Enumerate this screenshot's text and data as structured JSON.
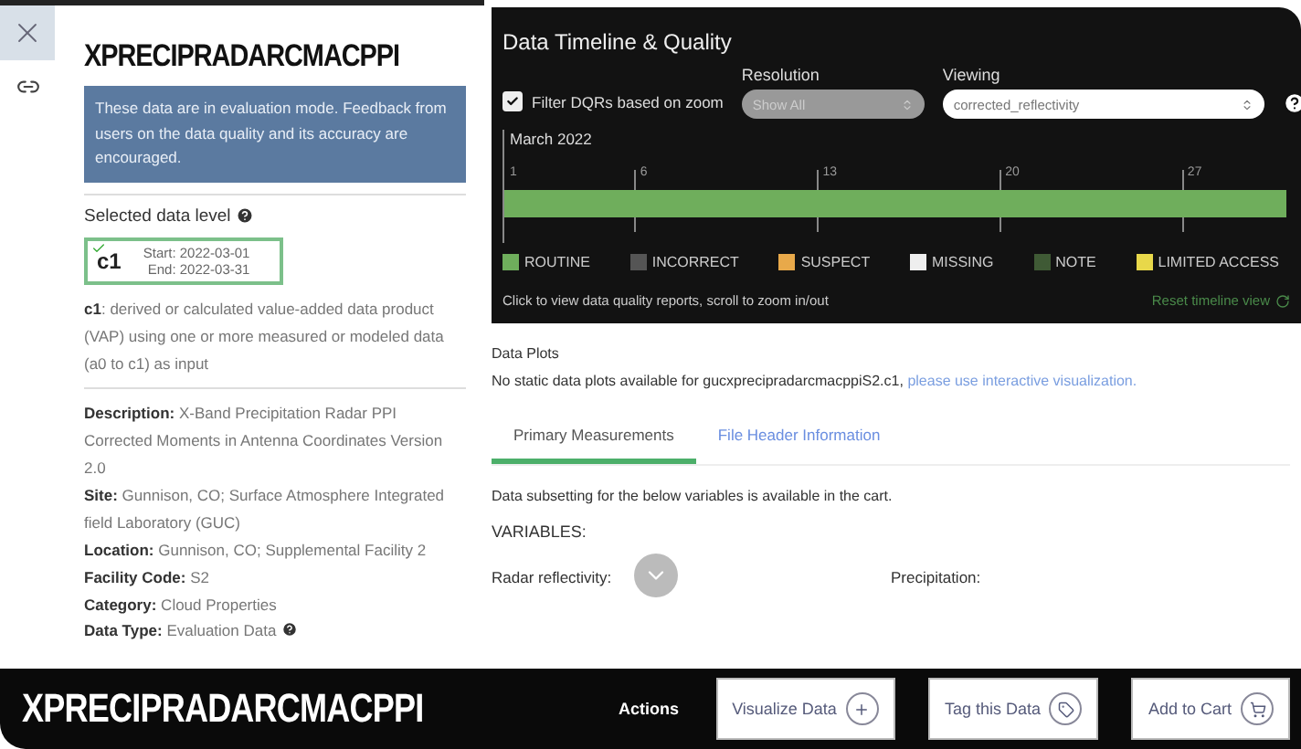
{
  "title": "XPRECIPRADARCMACPPI",
  "notice": "These data are in evaluation mode. Feedback from users on the data quality and its accuracy are encouraged.",
  "data_level": {
    "heading": "Selected data level",
    "code": "c1",
    "start": "Start: 2022-03-01",
    "end": "End: 2022-03-31",
    "selected": true
  },
  "level_description": "**c1**: derived or calculated value-added data product (VAP) using one or more measured or modeled data (a0 to c1) as input",
  "details": [
    {
      "text": "**Description:** X-Band Precipitation Radar PPI Corrected Moments in Antenna Coordinates Version 2.0",
      "help": false
    },
    {
      "text": "**Site:** Gunnison, CO; Surface Atmosphere Integrated field Laboratory (GUC)",
      "help": false
    },
    {
      "text": "**Location:** Gunnison, CO; Supplemental Facility 2",
      "help": false
    },
    {
      "text": "**Facility Code:** S2",
      "help": false
    },
    {
      "text": "**Category:** Cloud Properties",
      "help": false
    },
    {
      "text": "**Data Type:** Evaluation Data",
      "help": true
    }
  ],
  "timeline": {
    "title": "Data Timeline & Quality",
    "filter": {
      "label": "Filter DQRs based on zoom",
      "checked": true
    },
    "resolution": {
      "label": "Resolution",
      "value": "Show All",
      "disabled": true
    },
    "viewing": {
      "label": "Viewing",
      "value": "corrected_reflectivity",
      "disabled": false
    },
    "month": "March 2022",
    "ticks": [
      "1",
      "6",
      "13",
      "20",
      "27"
    ],
    "legend": [
      {
        "label": "ROUTINE",
        "color": "#6fae5c"
      },
      {
        "label": "INCORRECT",
        "color": "#555555"
      },
      {
        "label": "SUSPECT",
        "color": "#e8a94a"
      },
      {
        "label": "MISSING",
        "color": "#eeeeee"
      },
      {
        "label": "NOTE",
        "color": "#3f5a35"
      },
      {
        "label": "LIMITED ACCESS",
        "color": "#e8d84a"
      }
    ],
    "hint": "Click to view data quality reports, scroll to zoom in/out",
    "reset": "Reset timeline view"
  },
  "plots": {
    "heading": "Data Plots",
    "text": "No static data plots available for gucxprecipradarcmacppiS2.c1,",
    "link": "please use interactive visualization."
  },
  "tabs": [
    {
      "label": "Primary Measurements",
      "selected": true
    },
    {
      "label": "File Header Information",
      "selected": false
    }
  ],
  "subset_note": "Data subsetting for the below variables is available in the cart.",
  "variables_heading": "VARIABLES:",
  "variables": [
    "Radar reflectivity:",
    "Precipitation:"
  ],
  "footer": {
    "title": "XPRECIPRADARCMACPPI",
    "actions_label": "Actions",
    "buttons": [
      {
        "label": "Visualize Data",
        "kind": "visualize"
      },
      {
        "label": "Tag this Data",
        "kind": "tag"
      },
      {
        "label": "Add to Cart",
        "kind": "cart"
      }
    ]
  }
}
